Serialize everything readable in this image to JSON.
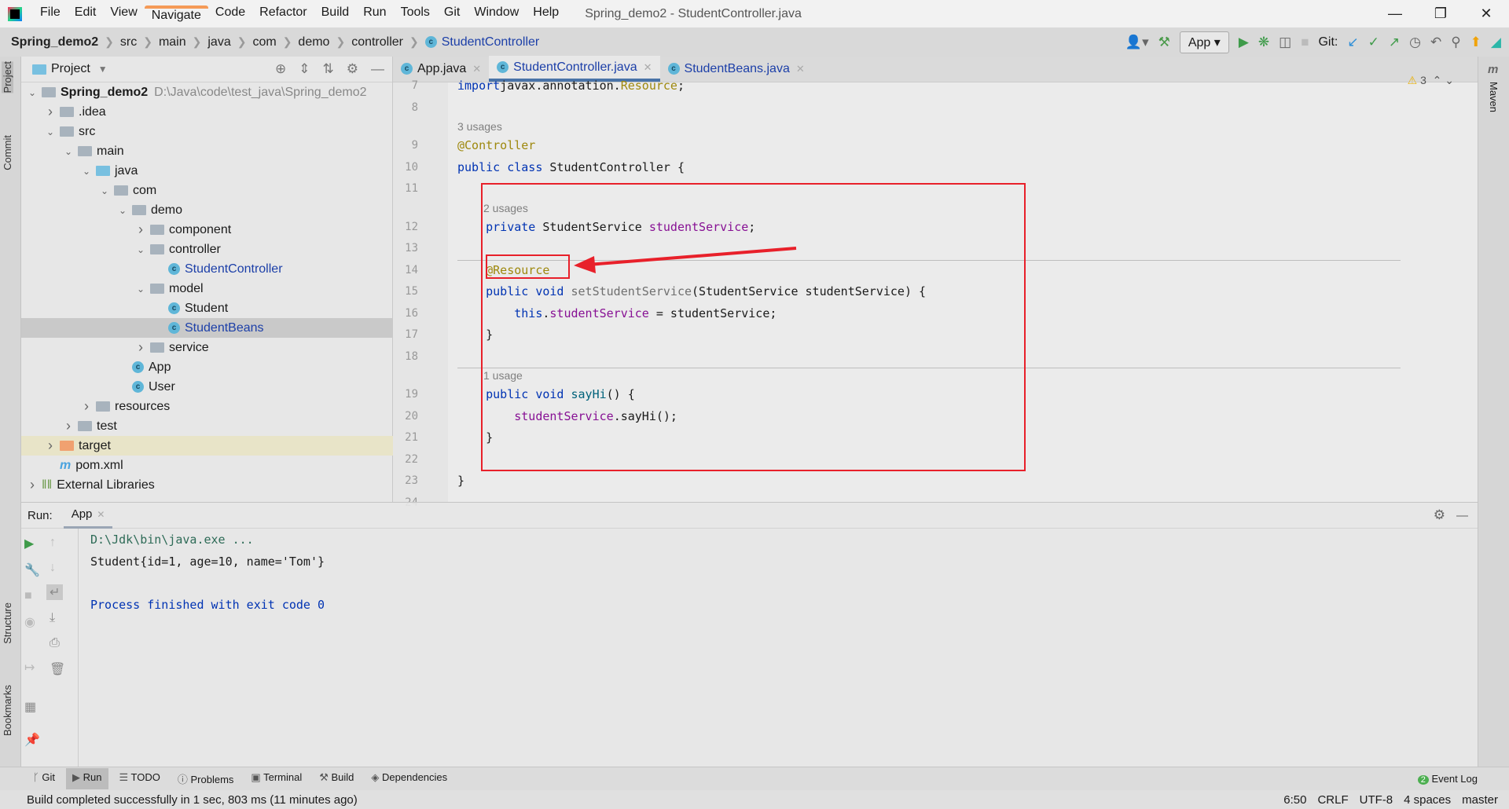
{
  "menubar": {
    "items": [
      "File",
      "Edit",
      "View",
      "Navigate",
      "Code",
      "Refactor",
      "Build",
      "Run",
      "Tools",
      "Git",
      "Window",
      "Help"
    ],
    "title": "Spring_demo2 - StudentController.java"
  },
  "breadcrumb": [
    "Spring_demo2",
    "src",
    "main",
    "java",
    "com",
    "demo",
    "controller",
    "StudentController"
  ],
  "toolbar": {
    "run_config": "App",
    "git_label": "Git:"
  },
  "sidebar_tabs": {
    "project": "Project",
    "commit": "Commit",
    "structure": "Structure",
    "bookmarks": "Bookmarks",
    "maven": "Maven"
  },
  "project": {
    "title": "Project",
    "tree": [
      {
        "label": "Spring_demo2",
        "path": "D:\\Java\\code\\test_java\\Spring_demo2",
        "depth": 0,
        "expanded": true,
        "kind": "module",
        "bold": true
      },
      {
        "label": ".idea",
        "depth": 1,
        "expanded": false,
        "kind": "folder"
      },
      {
        "label": "src",
        "depth": 1,
        "expanded": true,
        "kind": "folder"
      },
      {
        "label": "main",
        "depth": 2,
        "expanded": true,
        "kind": "folder"
      },
      {
        "label": "java",
        "depth": 3,
        "expanded": true,
        "kind": "src"
      },
      {
        "label": "com",
        "depth": 4,
        "expanded": true,
        "kind": "package"
      },
      {
        "label": "demo",
        "depth": 5,
        "expanded": true,
        "kind": "package"
      },
      {
        "label": "component",
        "depth": 6,
        "expanded": false,
        "kind": "package"
      },
      {
        "label": "controller",
        "depth": 6,
        "expanded": true,
        "kind": "package"
      },
      {
        "label": "StudentController",
        "depth": 7,
        "kind": "class",
        "link": true
      },
      {
        "label": "model",
        "depth": 6,
        "expanded": true,
        "kind": "package"
      },
      {
        "label": "Student",
        "depth": 7,
        "kind": "class"
      },
      {
        "label": "StudentBeans",
        "depth": 7,
        "kind": "class",
        "link": true,
        "selected": true
      },
      {
        "label": "service",
        "depth": 6,
        "expanded": false,
        "kind": "package"
      },
      {
        "label": "App",
        "depth": 5,
        "kind": "class"
      },
      {
        "label": "User",
        "depth": 5,
        "kind": "class"
      },
      {
        "label": "resources",
        "depth": 3,
        "expanded": false,
        "kind": "folder"
      },
      {
        "label": "test",
        "depth": 2,
        "expanded": false,
        "kind": "folder"
      },
      {
        "label": "target",
        "depth": 1,
        "expanded": false,
        "kind": "target"
      },
      {
        "label": "pom.xml",
        "depth": 1,
        "kind": "maven"
      },
      {
        "label": "External Libraries",
        "depth": 0,
        "expanded": false,
        "kind": "libs"
      }
    ]
  },
  "editor": {
    "tabs": [
      {
        "label": "App.java",
        "active": false
      },
      {
        "label": "StudentController.java",
        "active": true
      },
      {
        "label": "StudentBeans.java",
        "active": false
      }
    ],
    "warnings": "3",
    "lines": [
      {
        "n": "7",
        "t": [
          [
            "kw",
            "import"
          ],
          [
            "",
            "javax.annotation."
          ],
          [
            "ann",
            "Resource"
          ],
          [
            "",
            ";"
          ]
        ]
      },
      {
        "n": "8",
        "t": []
      },
      {
        "inlay": "3 usages",
        "indent": 0
      },
      {
        "n": "9",
        "t": [
          [
            "ann",
            "@Controller"
          ]
        ]
      },
      {
        "n": "10",
        "t": [
          [
            "kw",
            "public class "
          ],
          [
            "",
            "StudentController {"
          ]
        ]
      },
      {
        "n": "11",
        "t": []
      },
      {
        "inlay": "2 usages",
        "indent": 1
      },
      {
        "n": "12",
        "t": [
          [
            "",
            "    "
          ],
          [
            "kw",
            "private "
          ],
          [
            "",
            "StudentService "
          ],
          [
            "fld",
            "studentService"
          ],
          [
            "",
            ";"
          ]
        ]
      },
      {
        "n": "13",
        "t": []
      },
      {
        "n": "14",
        "t": [
          [
            "",
            "    "
          ],
          [
            "ann",
            "@Resource"
          ]
        ]
      },
      {
        "n": "15",
        "t": [
          [
            "",
            "    "
          ],
          [
            "kw",
            "public void "
          ],
          [
            "unused",
            "setStudentService"
          ],
          [
            "",
            "(StudentService studentService) {"
          ]
        ]
      },
      {
        "n": "16",
        "t": [
          [
            "",
            "        "
          ],
          [
            "kw",
            "this"
          ],
          [
            "",
            "."
          ],
          [
            "fld",
            "studentService"
          ],
          [
            "",
            " = studentService;"
          ]
        ]
      },
      {
        "n": "17",
        "t": [
          [
            "",
            "    }"
          ]
        ]
      },
      {
        "n": "18",
        "t": []
      },
      {
        "inlay": "1 usage",
        "indent": 1
      },
      {
        "n": "19",
        "t": [
          [
            "",
            "    "
          ],
          [
            "kw",
            "public void "
          ],
          [
            "mth",
            "sayHi"
          ],
          [
            "",
            "() {"
          ]
        ]
      },
      {
        "n": "20",
        "t": [
          [
            "",
            "        "
          ],
          [
            "fld",
            "studentService"
          ],
          [
            "",
            ".sayHi();"
          ]
        ]
      },
      {
        "n": "21",
        "t": [
          [
            "",
            "    }"
          ]
        ]
      },
      {
        "n": "22",
        "t": []
      },
      {
        "n": "23",
        "t": [
          [
            "",
            "}"
          ]
        ]
      },
      {
        "n": "24",
        "t": []
      }
    ]
  },
  "run": {
    "label": "Run:",
    "tab": "App",
    "console": [
      {
        "text": "D:\\Jdk\\bin\\java.exe ...",
        "color": "#2e6b57"
      },
      {
        "text": "Student{id=1, age=10, name='Tom'}",
        "color": "#1a1a1a"
      },
      {
        "text": "",
        "color": "#1a1a1a"
      },
      {
        "text": "Process finished with exit code 0",
        "color": "#0033b3"
      }
    ]
  },
  "bottom_tabs": [
    "Git",
    "Run",
    "TODO",
    "Problems",
    "Terminal",
    "Build",
    "Dependencies"
  ],
  "event_log": {
    "label": "Event Log",
    "count": "2"
  },
  "status": {
    "message": "Build completed successfully in 1 sec, 803 ms (11 minutes ago)",
    "position": "6:50",
    "line_sep": "CRLF",
    "encoding": "UTF-8",
    "indent": "4 spaces",
    "branch": "master"
  },
  "colors": {
    "annotation_box": "#e8202a",
    "keyword": "#0033b3",
    "annotation": "#9e880d",
    "field": "#871094"
  }
}
